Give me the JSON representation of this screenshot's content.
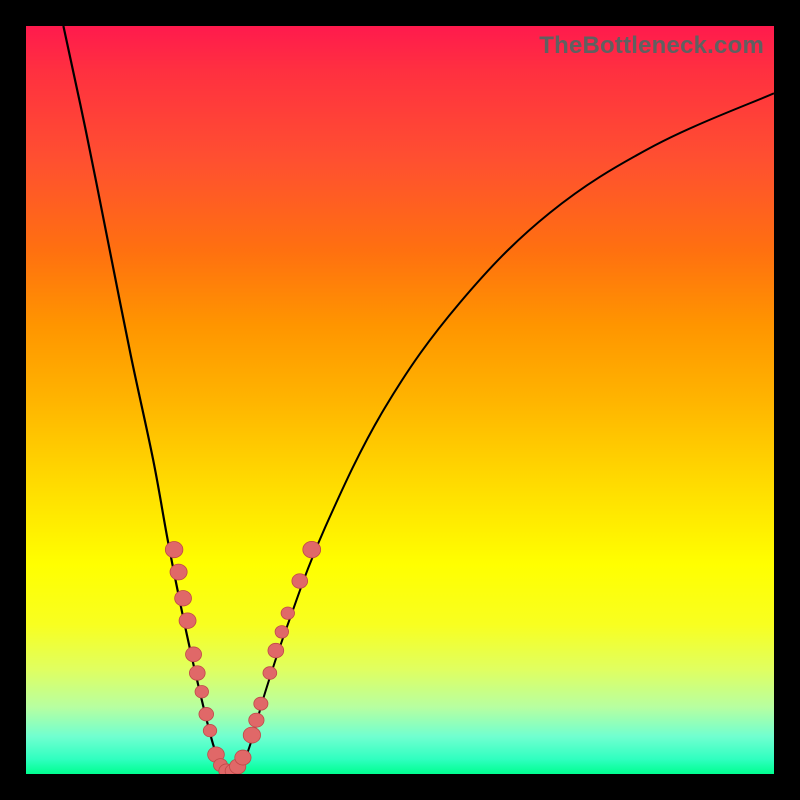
{
  "watermark": "TheBottleneck.com",
  "chart_data": {
    "type": "line",
    "title": "",
    "xlabel": "",
    "ylabel": "",
    "xlim": [
      0,
      100
    ],
    "ylim": [
      0,
      100
    ],
    "background": "gradient red-yellow-green (top-to-bottom)",
    "series": [
      {
        "name": "left-branch",
        "x": [
          5,
          8,
          11,
          14,
          17,
          19,
          21,
          23,
          25,
          26.5
        ],
        "y": [
          100,
          86,
          71,
          56,
          42,
          31,
          21,
          12,
          4,
          0
        ]
      },
      {
        "name": "right-branch",
        "x": [
          28.5,
          30,
          32,
          35,
          40,
          48,
          58,
          70,
          84,
          100
        ],
        "y": [
          0,
          4,
          11,
          20,
          33,
          49,
          63,
          75,
          84,
          91
        ]
      }
    ],
    "markers": [
      {
        "name": "left-cluster-upper",
        "points": [
          {
            "x": 19.8,
            "y": 30
          },
          {
            "x": 20.4,
            "y": 27
          },
          {
            "x": 21.0,
            "y": 23.5
          },
          {
            "x": 21.6,
            "y": 20.5
          }
        ]
      },
      {
        "name": "left-cluster-mid",
        "points": [
          {
            "x": 22.4,
            "y": 16
          },
          {
            "x": 22.9,
            "y": 13.5
          },
          {
            "x": 23.5,
            "y": 11
          },
          {
            "x": 24.1,
            "y": 8
          },
          {
            "x": 24.6,
            "y": 5.8
          }
        ]
      },
      {
        "name": "bottom-cluster",
        "points": [
          {
            "x": 25.4,
            "y": 2.6
          },
          {
            "x": 26.0,
            "y": 1.2
          },
          {
            "x": 26.8,
            "y": 0.4
          },
          {
            "x": 27.6,
            "y": 0.4
          },
          {
            "x": 28.3,
            "y": 1.0
          },
          {
            "x": 29.0,
            "y": 2.2
          }
        ]
      },
      {
        "name": "right-cluster-lower",
        "points": [
          {
            "x": 30.2,
            "y": 5.2
          },
          {
            "x": 30.8,
            "y": 7.2
          },
          {
            "x": 31.4,
            "y": 9.4
          }
        ]
      },
      {
        "name": "right-cluster-mid",
        "points": [
          {
            "x": 32.6,
            "y": 13.5
          },
          {
            "x": 33.4,
            "y": 16.5
          },
          {
            "x": 34.2,
            "y": 19.0
          },
          {
            "x": 35.0,
            "y": 21.5
          }
        ]
      },
      {
        "name": "right-cluster-upper",
        "points": [
          {
            "x": 36.6,
            "y": 25.8
          },
          {
            "x": 38.2,
            "y": 30.0
          }
        ]
      }
    ]
  }
}
